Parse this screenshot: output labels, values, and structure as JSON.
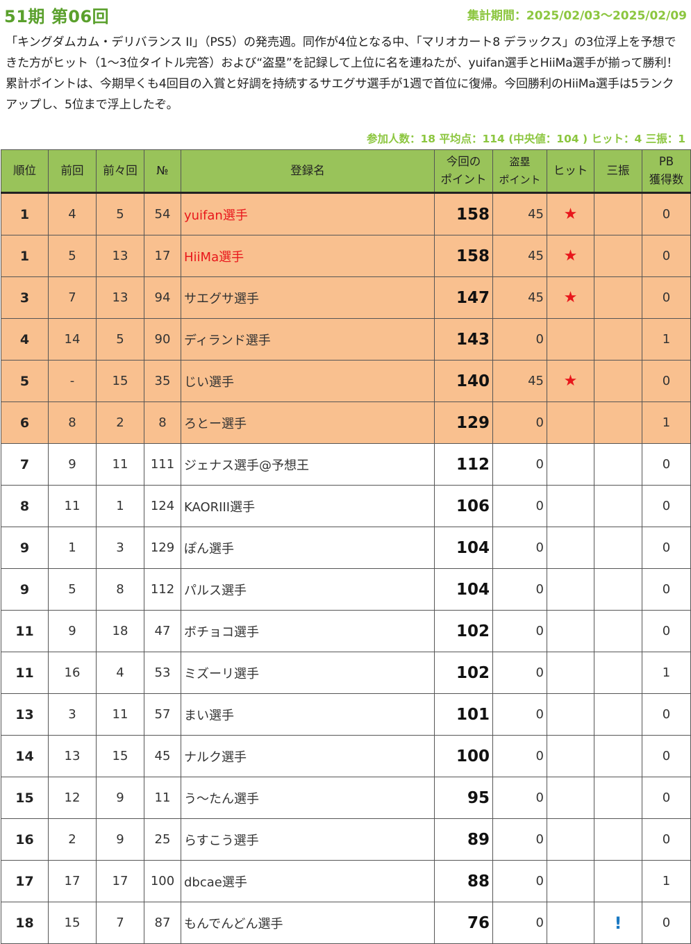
{
  "header": {
    "title": "51期 第06回",
    "period": "集計期間：2025/02/03～2025/02/09"
  },
  "summary": "「キングダムカム・デリバランス II」（PS5）の発売週。同作が4位となる中、「マリオカート8 デラックス」の3位浮上を予想できた方がヒット（1～3位タイトル完答）および“盗塁”を記録して上位に名を連ねたが、yuifan選手とHiiMa選手が揃って勝利！ 累計ポイントは、今期早くも4回目の入賞と好調を持続するサエグサ選手が1週で首位に復帰。今回勝利のHiiMa選手は5ランクアップし、5位まで浮上したぞ。",
  "stats": "参加人数：18 平均点：114 (中央値：104 ) ヒット：4 三振：1",
  "columns": {
    "rank": "順位",
    "prev": "前回",
    "prev2": "前々回",
    "no": "№",
    "name": "登録名",
    "points_l1": "今回の",
    "points_l2": "ポイント",
    "steal_l1": "盗塁",
    "steal_l2": "ポイント",
    "hit": "ヒット",
    "strikeout": "三振",
    "pb_l1": "PB",
    "pb_l2": "獲得数"
  },
  "colors": {
    "header_bg": "#99c35a",
    "highlight_row": "#f9c08f",
    "title_green": "#5aa02c",
    "accent_green": "#8cc63f",
    "red": "#e8161b",
    "blue": "#1a78c2"
  },
  "rows": [
    {
      "rank": "1",
      "prev": "4",
      "prev2": "5",
      "no": "54",
      "name": "yuifan選手",
      "points": "158",
      "steal": "45",
      "hit": "★",
      "strikeout": "",
      "pb": "0",
      "highlight": true,
      "red_name": true
    },
    {
      "rank": "1",
      "prev": "5",
      "prev2": "13",
      "no": "17",
      "name": "HiiMa選手",
      "points": "158",
      "steal": "45",
      "hit": "★",
      "strikeout": "",
      "pb": "0",
      "highlight": true,
      "red_name": true
    },
    {
      "rank": "3",
      "prev": "7",
      "prev2": "13",
      "no": "94",
      "name": "サエグサ選手",
      "points": "147",
      "steal": "45",
      "hit": "★",
      "strikeout": "",
      "pb": "0",
      "highlight": true,
      "red_name": false
    },
    {
      "rank": "4",
      "prev": "14",
      "prev2": "5",
      "no": "90",
      "name": "ディランド選手",
      "points": "143",
      "steal": "0",
      "hit": "",
      "strikeout": "",
      "pb": "1",
      "highlight": true,
      "red_name": false
    },
    {
      "rank": "5",
      "prev": "-",
      "prev2": "15",
      "no": "35",
      "name": "じい選手",
      "points": "140",
      "steal": "45",
      "hit": "★",
      "strikeout": "",
      "pb": "0",
      "highlight": true,
      "red_name": false
    },
    {
      "rank": "6",
      "prev": "8",
      "prev2": "2",
      "no": "8",
      "name": "ろとー選手",
      "points": "129",
      "steal": "0",
      "hit": "",
      "strikeout": "",
      "pb": "1",
      "highlight": true,
      "red_name": false
    },
    {
      "rank": "7",
      "prev": "9",
      "prev2": "11",
      "no": "111",
      "name": "ジェナス選手@予想王",
      "points": "112",
      "steal": "0",
      "hit": "",
      "strikeout": "",
      "pb": "0",
      "highlight": false,
      "red_name": false
    },
    {
      "rank": "8",
      "prev": "11",
      "prev2": "1",
      "no": "124",
      "name": "KAORIII選手",
      "points": "106",
      "steal": "0",
      "hit": "",
      "strikeout": "",
      "pb": "0",
      "highlight": false,
      "red_name": false
    },
    {
      "rank": "9",
      "prev": "1",
      "prev2": "3",
      "no": "129",
      "name": "ぽん選手",
      "points": "104",
      "steal": "0",
      "hit": "",
      "strikeout": "",
      "pb": "0",
      "highlight": false,
      "red_name": false
    },
    {
      "rank": "9",
      "prev": "5",
      "prev2": "8",
      "no": "112",
      "name": "パルス選手",
      "points": "104",
      "steal": "0",
      "hit": "",
      "strikeout": "",
      "pb": "0",
      "highlight": false,
      "red_name": false
    },
    {
      "rank": "11",
      "prev": "9",
      "prev2": "18",
      "no": "47",
      "name": "ボチョコ選手",
      "points": "102",
      "steal": "0",
      "hit": "",
      "strikeout": "",
      "pb": "0",
      "highlight": false,
      "red_name": false
    },
    {
      "rank": "11",
      "prev": "16",
      "prev2": "4",
      "no": "53",
      "name": "ミズーリ選手",
      "points": "102",
      "steal": "0",
      "hit": "",
      "strikeout": "",
      "pb": "1",
      "highlight": false,
      "red_name": false
    },
    {
      "rank": "13",
      "prev": "3",
      "prev2": "11",
      "no": "57",
      "name": "まい選手",
      "points": "101",
      "steal": "0",
      "hit": "",
      "strikeout": "",
      "pb": "0",
      "highlight": false,
      "red_name": false
    },
    {
      "rank": "14",
      "prev": "13",
      "prev2": "15",
      "no": "45",
      "name": "ナルク選手",
      "points": "100",
      "steal": "0",
      "hit": "",
      "strikeout": "",
      "pb": "0",
      "highlight": false,
      "red_name": false
    },
    {
      "rank": "15",
      "prev": "12",
      "prev2": "9",
      "no": "11",
      "name": "う～たん選手",
      "points": "95",
      "steal": "0",
      "hit": "",
      "strikeout": "",
      "pb": "0",
      "highlight": false,
      "red_name": false
    },
    {
      "rank": "16",
      "prev": "2",
      "prev2": "9",
      "no": "25",
      "name": "らすこう選手",
      "points": "89",
      "steal": "0",
      "hit": "",
      "strikeout": "",
      "pb": "0",
      "highlight": false,
      "red_name": false
    },
    {
      "rank": "17",
      "prev": "17",
      "prev2": "17",
      "no": "100",
      "name": "dbcae選手",
      "points": "88",
      "steal": "0",
      "hit": "",
      "strikeout": "",
      "pb": "1",
      "highlight": false,
      "red_name": false
    },
    {
      "rank": "18",
      "prev": "15",
      "prev2": "7",
      "no": "87",
      "name": "もんでんどん選手",
      "points": "76",
      "steal": "0",
      "hit": "",
      "strikeout": "!",
      "pb": "0",
      "highlight": false,
      "red_name": false
    }
  ]
}
